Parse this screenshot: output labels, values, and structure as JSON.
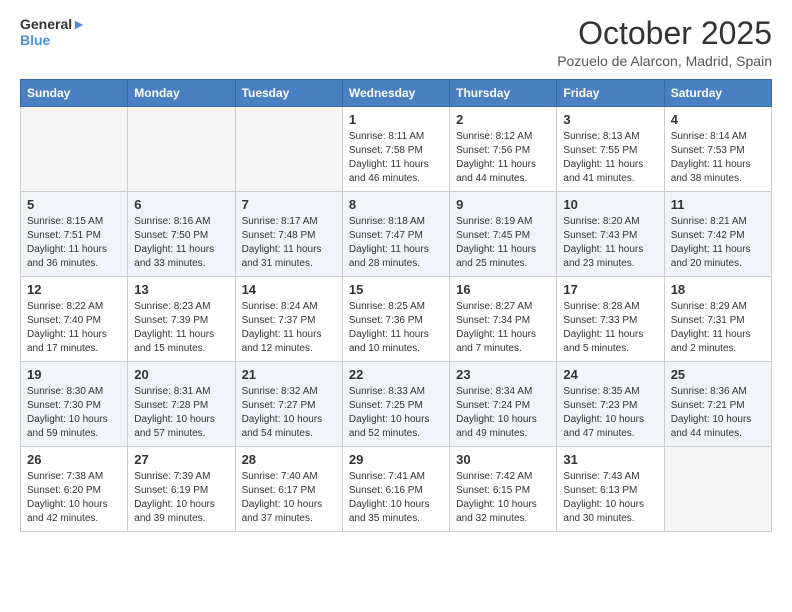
{
  "header": {
    "logo_general": "General",
    "logo_blue": "Blue",
    "month_title": "October 2025",
    "location": "Pozuelo de Alarcon, Madrid, Spain"
  },
  "calendar": {
    "weekdays": [
      "Sunday",
      "Monday",
      "Tuesday",
      "Wednesday",
      "Thursday",
      "Friday",
      "Saturday"
    ],
    "weeks": [
      [
        {
          "day": "",
          "sunrise": "",
          "sunset": "",
          "daylight": ""
        },
        {
          "day": "",
          "sunrise": "",
          "sunset": "",
          "daylight": ""
        },
        {
          "day": "",
          "sunrise": "",
          "sunset": "",
          "daylight": ""
        },
        {
          "day": "1",
          "sunrise": "Sunrise: 8:11 AM",
          "sunset": "Sunset: 7:58 PM",
          "daylight": "Daylight: 11 hours and 46 minutes."
        },
        {
          "day": "2",
          "sunrise": "Sunrise: 8:12 AM",
          "sunset": "Sunset: 7:56 PM",
          "daylight": "Daylight: 11 hours and 44 minutes."
        },
        {
          "day": "3",
          "sunrise": "Sunrise: 8:13 AM",
          "sunset": "Sunset: 7:55 PM",
          "daylight": "Daylight: 11 hours and 41 minutes."
        },
        {
          "day": "4",
          "sunrise": "Sunrise: 8:14 AM",
          "sunset": "Sunset: 7:53 PM",
          "daylight": "Daylight: 11 hours and 38 minutes."
        }
      ],
      [
        {
          "day": "5",
          "sunrise": "Sunrise: 8:15 AM",
          "sunset": "Sunset: 7:51 PM",
          "daylight": "Daylight: 11 hours and 36 minutes."
        },
        {
          "day": "6",
          "sunrise": "Sunrise: 8:16 AM",
          "sunset": "Sunset: 7:50 PM",
          "daylight": "Daylight: 11 hours and 33 minutes."
        },
        {
          "day": "7",
          "sunrise": "Sunrise: 8:17 AM",
          "sunset": "Sunset: 7:48 PM",
          "daylight": "Daylight: 11 hours and 31 minutes."
        },
        {
          "day": "8",
          "sunrise": "Sunrise: 8:18 AM",
          "sunset": "Sunset: 7:47 PM",
          "daylight": "Daylight: 11 hours and 28 minutes."
        },
        {
          "day": "9",
          "sunrise": "Sunrise: 8:19 AM",
          "sunset": "Sunset: 7:45 PM",
          "daylight": "Daylight: 11 hours and 25 minutes."
        },
        {
          "day": "10",
          "sunrise": "Sunrise: 8:20 AM",
          "sunset": "Sunset: 7:43 PM",
          "daylight": "Daylight: 11 hours and 23 minutes."
        },
        {
          "day": "11",
          "sunrise": "Sunrise: 8:21 AM",
          "sunset": "Sunset: 7:42 PM",
          "daylight": "Daylight: 11 hours and 20 minutes."
        }
      ],
      [
        {
          "day": "12",
          "sunrise": "Sunrise: 8:22 AM",
          "sunset": "Sunset: 7:40 PM",
          "daylight": "Daylight: 11 hours and 17 minutes."
        },
        {
          "day": "13",
          "sunrise": "Sunrise: 8:23 AM",
          "sunset": "Sunset: 7:39 PM",
          "daylight": "Daylight: 11 hours and 15 minutes."
        },
        {
          "day": "14",
          "sunrise": "Sunrise: 8:24 AM",
          "sunset": "Sunset: 7:37 PM",
          "daylight": "Daylight: 11 hours and 12 minutes."
        },
        {
          "day": "15",
          "sunrise": "Sunrise: 8:25 AM",
          "sunset": "Sunset: 7:36 PM",
          "daylight": "Daylight: 11 hours and 10 minutes."
        },
        {
          "day": "16",
          "sunrise": "Sunrise: 8:27 AM",
          "sunset": "Sunset: 7:34 PM",
          "daylight": "Daylight: 11 hours and 7 minutes."
        },
        {
          "day": "17",
          "sunrise": "Sunrise: 8:28 AM",
          "sunset": "Sunset: 7:33 PM",
          "daylight": "Daylight: 11 hours and 5 minutes."
        },
        {
          "day": "18",
          "sunrise": "Sunrise: 8:29 AM",
          "sunset": "Sunset: 7:31 PM",
          "daylight": "Daylight: 11 hours and 2 minutes."
        }
      ],
      [
        {
          "day": "19",
          "sunrise": "Sunrise: 8:30 AM",
          "sunset": "Sunset: 7:30 PM",
          "daylight": "Daylight: 10 hours and 59 minutes."
        },
        {
          "day": "20",
          "sunrise": "Sunrise: 8:31 AM",
          "sunset": "Sunset: 7:28 PM",
          "daylight": "Daylight: 10 hours and 57 minutes."
        },
        {
          "day": "21",
          "sunrise": "Sunrise: 8:32 AM",
          "sunset": "Sunset: 7:27 PM",
          "daylight": "Daylight: 10 hours and 54 minutes."
        },
        {
          "day": "22",
          "sunrise": "Sunrise: 8:33 AM",
          "sunset": "Sunset: 7:25 PM",
          "daylight": "Daylight: 10 hours and 52 minutes."
        },
        {
          "day": "23",
          "sunrise": "Sunrise: 8:34 AM",
          "sunset": "Sunset: 7:24 PM",
          "daylight": "Daylight: 10 hours and 49 minutes."
        },
        {
          "day": "24",
          "sunrise": "Sunrise: 8:35 AM",
          "sunset": "Sunset: 7:23 PM",
          "daylight": "Daylight: 10 hours and 47 minutes."
        },
        {
          "day": "25",
          "sunrise": "Sunrise: 8:36 AM",
          "sunset": "Sunset: 7:21 PM",
          "daylight": "Daylight: 10 hours and 44 minutes."
        }
      ],
      [
        {
          "day": "26",
          "sunrise": "Sunrise: 7:38 AM",
          "sunset": "Sunset: 6:20 PM",
          "daylight": "Daylight: 10 hours and 42 minutes."
        },
        {
          "day": "27",
          "sunrise": "Sunrise: 7:39 AM",
          "sunset": "Sunset: 6:19 PM",
          "daylight": "Daylight: 10 hours and 39 minutes."
        },
        {
          "day": "28",
          "sunrise": "Sunrise: 7:40 AM",
          "sunset": "Sunset: 6:17 PM",
          "daylight": "Daylight: 10 hours and 37 minutes."
        },
        {
          "day": "29",
          "sunrise": "Sunrise: 7:41 AM",
          "sunset": "Sunset: 6:16 PM",
          "daylight": "Daylight: 10 hours and 35 minutes."
        },
        {
          "day": "30",
          "sunrise": "Sunrise: 7:42 AM",
          "sunset": "Sunset: 6:15 PM",
          "daylight": "Daylight: 10 hours and 32 minutes."
        },
        {
          "day": "31",
          "sunrise": "Sunrise: 7:43 AM",
          "sunset": "Sunset: 6:13 PM",
          "daylight": "Daylight: 10 hours and 30 minutes."
        },
        {
          "day": "",
          "sunrise": "",
          "sunset": "",
          "daylight": ""
        }
      ]
    ]
  }
}
